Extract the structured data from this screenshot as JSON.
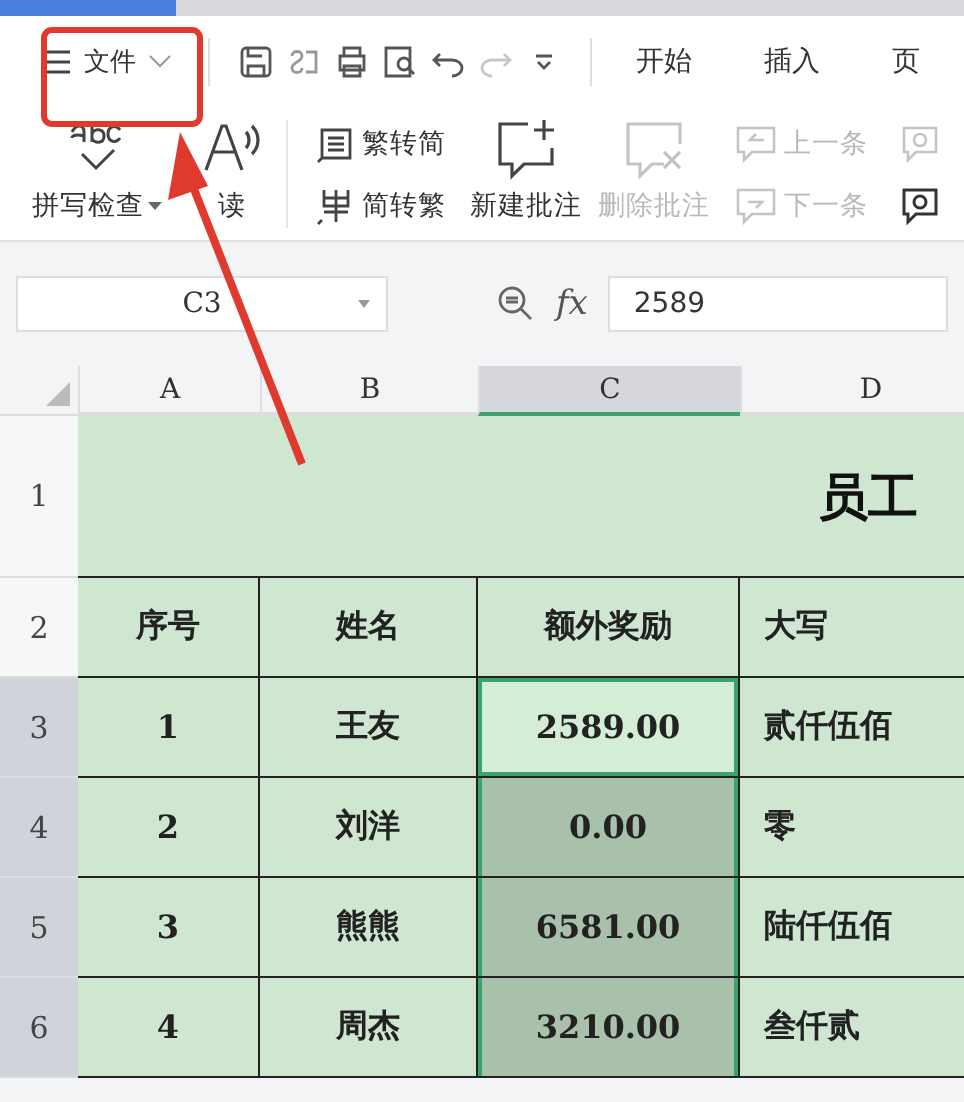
{
  "quick_toolbar": {
    "file_menu": "文件",
    "tabs": [
      {
        "label": "开始",
        "selected": false
      },
      {
        "label": "插入",
        "selected": false
      },
      {
        "label": "页",
        "selected": false
      }
    ]
  },
  "ribbon": {
    "items": [
      {
        "kind": "large",
        "label": "拼写检查",
        "dropdown": true,
        "disabled": false
      },
      {
        "kind": "large",
        "label": "读",
        "dropdown": false,
        "disabled": false
      },
      {
        "kind": "pair",
        "items": [
          {
            "label": "繁转简",
            "disabled": false
          },
          {
            "label": "简转繁",
            "disabled": false
          }
        ]
      },
      {
        "kind": "large",
        "label": "新建批注",
        "dropdown": false,
        "disabled": false
      },
      {
        "kind": "large",
        "label": "删除批注",
        "dropdown": false,
        "disabled": true
      },
      {
        "kind": "pair",
        "items": [
          {
            "label": "上一条",
            "disabled": true
          },
          {
            "label": "下一条",
            "disabled": true
          }
        ]
      }
    ]
  },
  "formula_bar": {
    "name_box": "C3",
    "function_label": "fx",
    "formula": "2589"
  },
  "sheet": {
    "columns": [
      {
        "label": "A",
        "selected": false
      },
      {
        "label": "B",
        "selected": false
      },
      {
        "label": "C",
        "selected": true
      },
      {
        "label": "D",
        "selected": false
      }
    ],
    "rows": [
      {
        "header": "1",
        "kind": "title",
        "selected": false,
        "title": "员工"
      },
      {
        "header": "2",
        "kind": "data",
        "selected": false,
        "cells": [
          {
            "text": "序号",
            "selected": false,
            "active": false
          },
          {
            "text": "姓名",
            "selected": false,
            "active": false
          },
          {
            "text": "额外奖励",
            "selected": false,
            "active": false
          },
          {
            "text": "大写",
            "selected": false,
            "active": false
          }
        ]
      },
      {
        "header": "3",
        "kind": "data",
        "selected": true,
        "cells": [
          {
            "text": "1",
            "selected": false,
            "active": false
          },
          {
            "text": "王友",
            "selected": false,
            "active": false
          },
          {
            "text": "2589.00",
            "selected": true,
            "active": true
          },
          {
            "text": "贰仟伍佰",
            "selected": false,
            "active": false
          }
        ]
      },
      {
        "header": "4",
        "kind": "data",
        "selected": true,
        "cells": [
          {
            "text": "2",
            "selected": false,
            "active": false
          },
          {
            "text": "刘洋",
            "selected": false,
            "active": false
          },
          {
            "text": "0.00",
            "selected": true,
            "active": false
          },
          {
            "text": "零",
            "selected": false,
            "active": false
          }
        ]
      },
      {
        "header": "5",
        "kind": "data",
        "selected": true,
        "cells": [
          {
            "text": "3",
            "selected": false,
            "active": false
          },
          {
            "text": "熊熊",
            "selected": false,
            "active": false
          },
          {
            "text": "6581.00",
            "selected": true,
            "active": false
          },
          {
            "text": "陆仟伍佰",
            "selected": false,
            "active": false
          }
        ]
      },
      {
        "header": "6",
        "kind": "data",
        "selected": true,
        "cells": [
          {
            "text": "4",
            "selected": false,
            "active": false
          },
          {
            "text": "周杰",
            "selected": false,
            "active": false
          },
          {
            "text": "3210.00",
            "selected": true,
            "active": false
          },
          {
            "text": "叁仟贰",
            "selected": false,
            "active": false
          }
        ]
      }
    ]
  }
}
